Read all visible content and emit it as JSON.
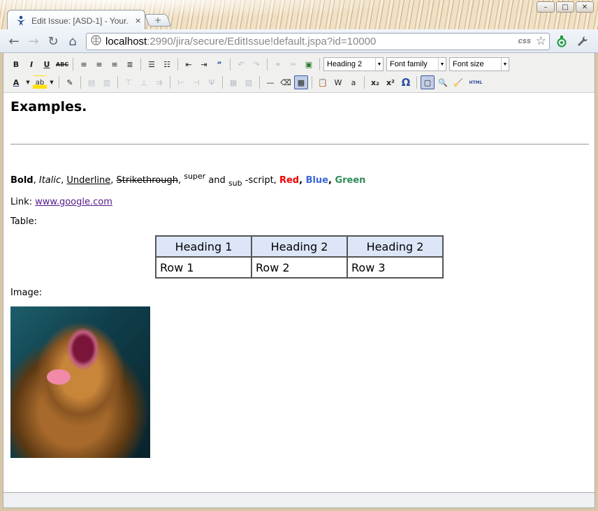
{
  "tab": {
    "title": "Edit Issue: [ASD-1] - Your...",
    "close": "×"
  },
  "newtab": {
    "label": "+"
  },
  "window": {
    "minimize": "–",
    "maximize": "□",
    "close": "✕"
  },
  "nav": {
    "back": "←",
    "forward": "→",
    "reload": "↻",
    "home": "⌂"
  },
  "omnibox": {
    "host": "localhost",
    "rest": ":2990/jira/secure/EditIssue!default.jspa?id=10000",
    "css_badge": "css",
    "star": "☆"
  },
  "toolbar": {
    "bold": "B",
    "italic": "I",
    "underline": "U",
    "strike": "ABC",
    "heading_select": "Heading 2",
    "font_family": "Font family",
    "font_size": "Font size",
    "font_color": "A",
    "highlight": "ab",
    "subscript": "x₂",
    "superscript": "x²",
    "omega": "Ω",
    "html": "HTML"
  },
  "editor": {
    "heading": "Examples.",
    "line1": {
      "bold": "Bold",
      "c1": ", ",
      "italic": "Italic",
      "c2": ", ",
      "underline": "Underline",
      "c3": ", ",
      "strike": "Strikethrough",
      "c4": ", ",
      "super": "super",
      "and": " and ",
      "sub": "sub",
      "script": " -script, ",
      "red": "Red",
      "c5": ", ",
      "blue": "Blue",
      "c6": ", ",
      "green": "Green"
    },
    "link_label": "Link: ",
    "link_text": "www.google.com",
    "table_label": "Table:",
    "table": {
      "headers": [
        "Heading 1",
        "Heading 2",
        "Heading 2"
      ],
      "row": [
        "Row 1",
        "Row 2",
        "Row 3"
      ]
    },
    "image_label": "Image:"
  }
}
